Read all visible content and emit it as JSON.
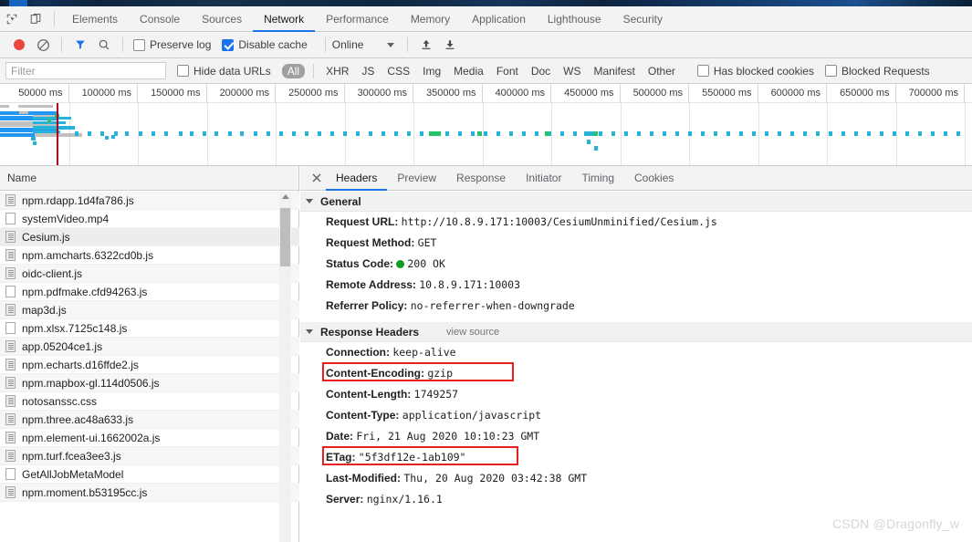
{
  "browser": {
    "strip_note": ""
  },
  "devtools": {
    "inspect_icon": "inspect-element-icon",
    "device_icon": "device-toolbar-icon",
    "tabs": [
      {
        "label": "Elements",
        "active": false
      },
      {
        "label": "Console",
        "active": false
      },
      {
        "label": "Sources",
        "active": false
      },
      {
        "label": "Network",
        "active": true
      },
      {
        "label": "Performance",
        "active": false
      },
      {
        "label": "Memory",
        "active": false
      },
      {
        "label": "Application",
        "active": false
      },
      {
        "label": "Lighthouse",
        "active": false
      },
      {
        "label": "Security",
        "active": false
      }
    ]
  },
  "network_toolbar": {
    "record_title": "record-button",
    "clear_title": "clear-button",
    "filter_icon": "funnel-icon",
    "search_icon": "search-icon",
    "preserve_log": {
      "label": "Preserve log",
      "checked": false
    },
    "disable_cache": {
      "label": "Disable cache",
      "checked": true
    },
    "throttle": {
      "value": "Online"
    },
    "import_icon": "upload-har-icon",
    "export_icon": "download-har-icon"
  },
  "filter_bar": {
    "filter_placeholder": "Filter",
    "filter_value": "",
    "hide_data_urls": {
      "label": "Hide data URLs",
      "checked": false
    },
    "types": [
      {
        "label": "All",
        "active": true
      },
      {
        "label": "XHR",
        "active": false
      },
      {
        "label": "JS",
        "active": false
      },
      {
        "label": "CSS",
        "active": false
      },
      {
        "label": "Img",
        "active": false
      },
      {
        "label": "Media",
        "active": false
      },
      {
        "label": "Font",
        "active": false
      },
      {
        "label": "Doc",
        "active": false
      },
      {
        "label": "WS",
        "active": false
      },
      {
        "label": "Manifest",
        "active": false
      },
      {
        "label": "Other",
        "active": false
      }
    ],
    "has_blocked_cookies": {
      "label": "Has blocked cookies",
      "checked": false
    },
    "blocked_requests": {
      "label": "Blocked Requests",
      "checked": false
    }
  },
  "overview": {
    "ticks": [
      "50000 ms",
      "100000 ms",
      "150000 ms",
      "200000 ms",
      "250000 ms",
      "300000 ms",
      "350000 ms",
      "400000 ms",
      "450000 ms",
      "500000 ms",
      "550000 ms",
      "600000 ms",
      "650000 ms",
      "700000 ms"
    ]
  },
  "requests_panel": {
    "column_header": "Name",
    "rows": [
      {
        "name": "npm.rdapp.1d4fa786.js",
        "kind": "script",
        "selected": false
      },
      {
        "name": "systemVideo.mp4",
        "kind": "other",
        "selected": false
      },
      {
        "name": "Cesium.js",
        "kind": "script",
        "selected": true
      },
      {
        "name": "npm.amcharts.6322cd0b.js",
        "kind": "script",
        "selected": false
      },
      {
        "name": "oidc-client.js",
        "kind": "script",
        "selected": false
      },
      {
        "name": "npm.pdfmake.cfd94263.js",
        "kind": "other",
        "selected": false
      },
      {
        "name": "map3d.js",
        "kind": "script",
        "selected": false
      },
      {
        "name": "npm.xlsx.7125c148.js",
        "kind": "other",
        "selected": false
      },
      {
        "name": "app.05204ce1.js",
        "kind": "script",
        "selected": false
      },
      {
        "name": "npm.echarts.d16ffde2.js",
        "kind": "script",
        "selected": false
      },
      {
        "name": "npm.mapbox-gl.114d0506.js",
        "kind": "script",
        "selected": false
      },
      {
        "name": "notosanssc.css",
        "kind": "script",
        "selected": false
      },
      {
        "name": "npm.three.ac48a633.js",
        "kind": "script",
        "selected": false
      },
      {
        "name": "npm.element-ui.1662002a.js",
        "kind": "script",
        "selected": false
      },
      {
        "name": "npm.turf.fcea3ee3.js",
        "kind": "script",
        "selected": false
      },
      {
        "name": "GetAllJobMetaModel",
        "kind": "other",
        "selected": false
      },
      {
        "name": "npm.moment.b53195cc.js",
        "kind": "script",
        "selected": false
      }
    ]
  },
  "details_panel": {
    "close_icon": "close-icon",
    "tabs": [
      {
        "label": "Headers",
        "active": true
      },
      {
        "label": "Preview",
        "active": false
      },
      {
        "label": "Response",
        "active": false
      },
      {
        "label": "Initiator",
        "active": false
      },
      {
        "label": "Timing",
        "active": false
      },
      {
        "label": "Cookies",
        "active": false
      }
    ],
    "general": {
      "title": "General",
      "rows": [
        {
          "key": "Request URL:",
          "value": "http://10.8.9.171:10003/CesiumUnminified/Cesium.js"
        },
        {
          "key": "Request Method:",
          "value": "GET"
        },
        {
          "key": "Status Code:",
          "value": "200 OK",
          "status_dot": "#0f9d1f"
        },
        {
          "key": "Remote Address:",
          "value": "10.8.9.171:10003"
        },
        {
          "key": "Referrer Policy:",
          "value": "no-referrer-when-downgrade"
        }
      ]
    },
    "response_headers": {
      "title": "Response Headers",
      "view_source": "view source",
      "rows": [
        {
          "key": "Connection:",
          "value": "keep-alive",
          "highlight": false
        },
        {
          "key": "Content-Encoding:",
          "value": "gzip",
          "highlight": true
        },
        {
          "key": "Content-Length:",
          "value": "1749257",
          "highlight": false
        },
        {
          "key": "Content-Type:",
          "value": "application/javascript",
          "highlight": false
        },
        {
          "key": "Date:",
          "value": "Fri, 21 Aug 2020 10:10:23 GMT",
          "highlight": false
        },
        {
          "key": "ETag:",
          "value": "\"5f3df12e-1ab109\"",
          "highlight": true
        },
        {
          "key": "Last-Modified:",
          "value": "Thu, 20 Aug 2020 03:42:38 GMT",
          "highlight": false
        },
        {
          "key": "Server:",
          "value": "nginx/1.16.1",
          "highlight": false
        }
      ]
    }
  },
  "watermark": "CSDN @Dragonfly_w",
  "colors": {
    "accent": "#1a73e8",
    "record": "#e8453c",
    "status_ok": "#0f9d1f",
    "highlight_box": "#e81f1f",
    "timeline_bar": "#25b3d8"
  }
}
